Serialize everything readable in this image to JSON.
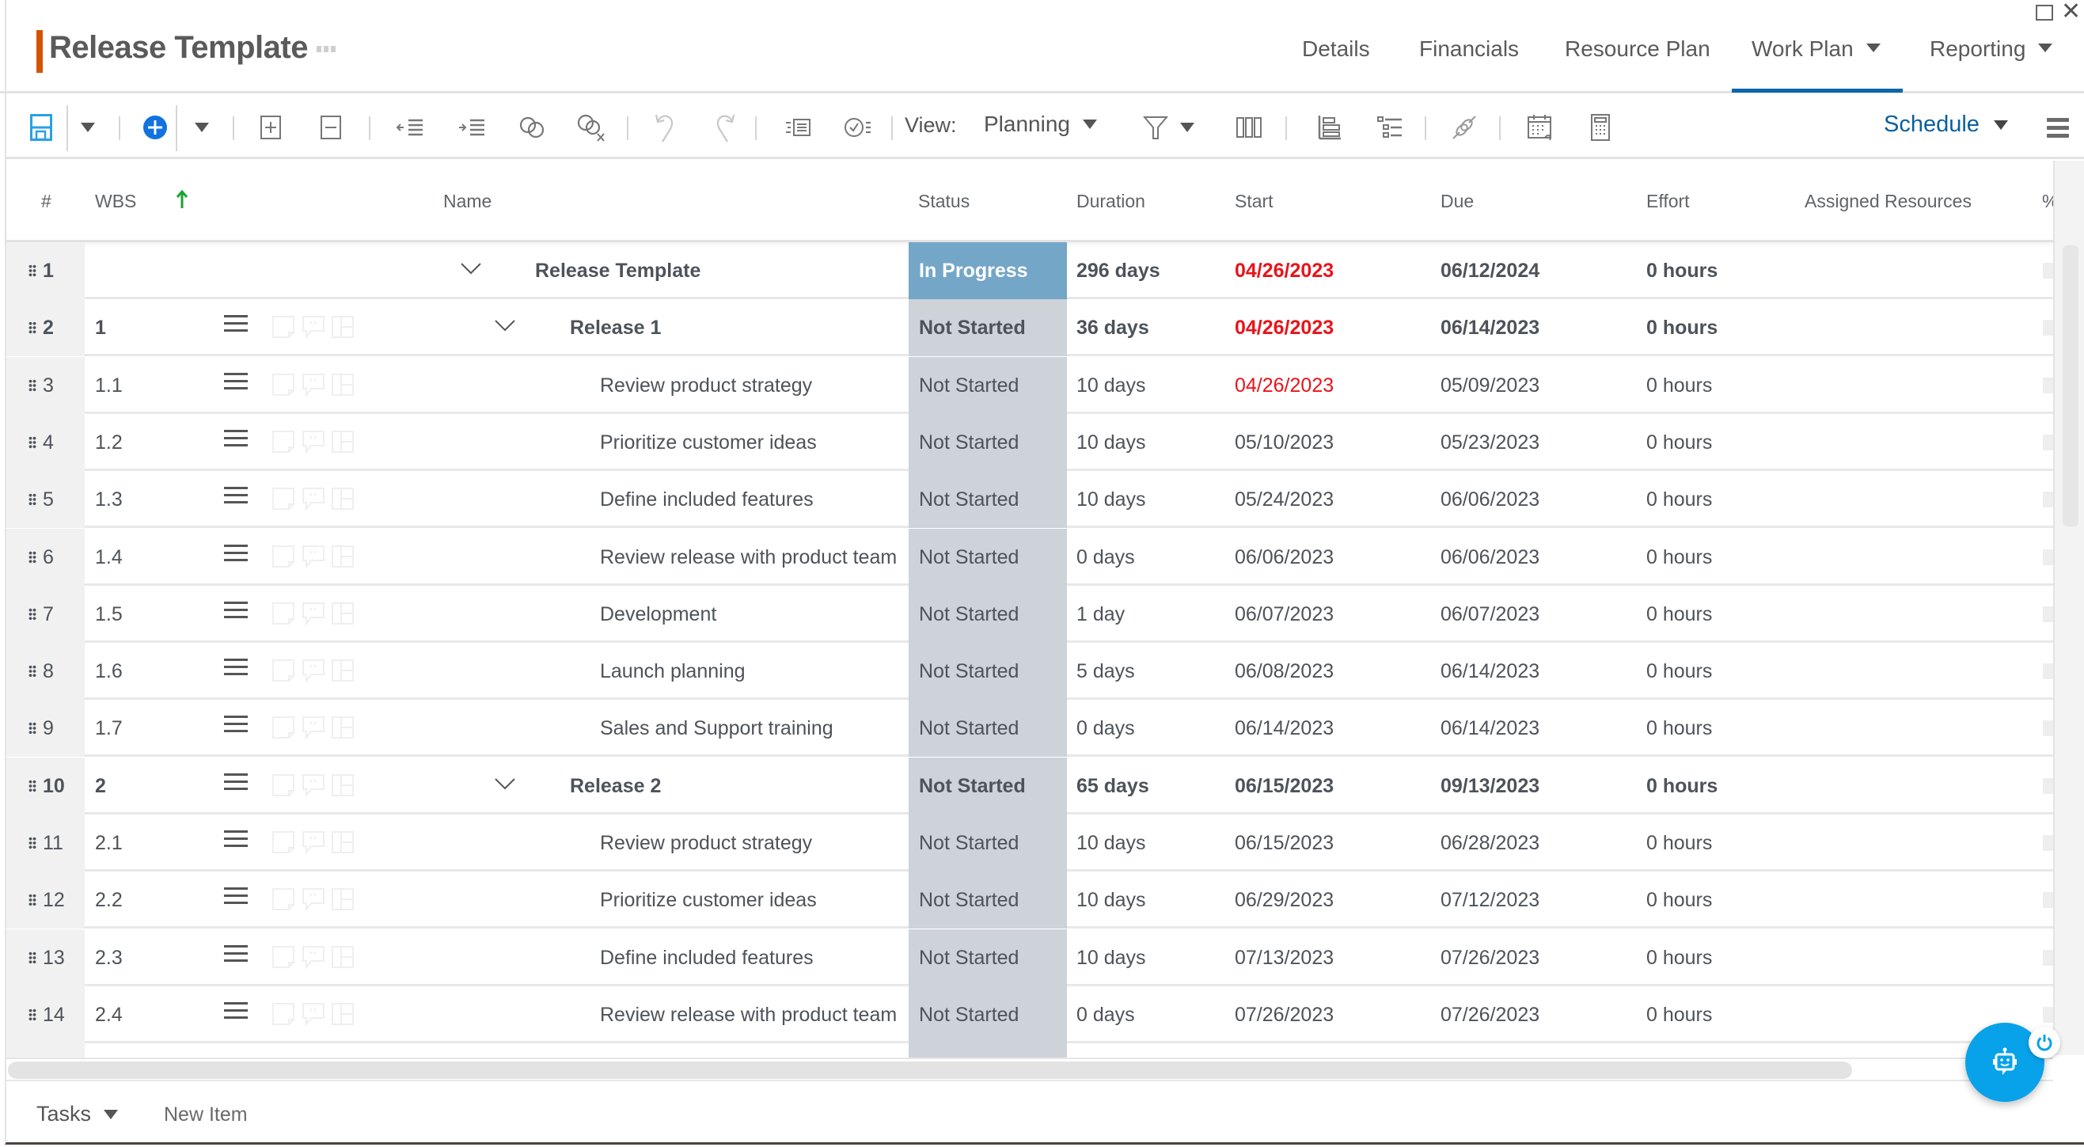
{
  "window": {
    "popout_icon": "popout-icon",
    "close_icon": "close-icon",
    "close_glyph": "✕"
  },
  "header": {
    "title": "Release Template",
    "more_icon": "more-dots-icon",
    "accent_color": "#d35400"
  },
  "nav": {
    "tabs": [
      {
        "label": "Details",
        "dropdown": false,
        "active": false
      },
      {
        "label": "Financials",
        "dropdown": false,
        "active": false
      },
      {
        "label": "Resource Plan",
        "dropdown": false,
        "active": false
      },
      {
        "label": "Work Plan",
        "dropdown": true,
        "active": true
      },
      {
        "label": "Reporting",
        "dropdown": true,
        "active": false
      }
    ],
    "active_color": "#0a68a8"
  },
  "toolbar": {
    "icons": [
      "save-icon",
      "add-icon",
      "expand-all-icon",
      "collapse-all-icon",
      "outdent-icon",
      "indent-icon",
      "link-icon",
      "unlink-icon",
      "undo-icon",
      "redo-icon",
      "details-panel-icon",
      "checklist-icon",
      "filter-icon",
      "columns-icon",
      "baseline-icon",
      "outline-icon",
      "dependency-icon",
      "calendar-icon",
      "calculator-icon",
      "menu-icon"
    ],
    "view_label": "View:",
    "view_value": "Planning",
    "schedule_label": "Schedule",
    "add_color": "#1172e0",
    "save_color": "#29a0e6"
  },
  "grid": {
    "columns": {
      "num": "#",
      "wbs": "WBS",
      "name": "Name",
      "status": "Status",
      "duration": "Duration",
      "start": "Start",
      "due": "Due",
      "effort": "Effort",
      "assigned": "Assigned Resources",
      "pct": "%"
    },
    "sort": {
      "column": "WBS",
      "direction": "ascending",
      "color": "#1aa332"
    },
    "status_colors": {
      "In Progress": "#74a6c8",
      "Not Started": "#ced2d9"
    },
    "late_date_color": "#e8131b",
    "rows": [
      {
        "num": "1",
        "wbs": "",
        "name": "Release Template",
        "level": 0,
        "summary": true,
        "status": "In Progress",
        "duration": "296 days",
        "start": "04/26/2023",
        "start_late": true,
        "due": "06/12/2024",
        "effort": "0 hours",
        "assigned": ""
      },
      {
        "num": "2",
        "wbs": "1",
        "name": "Release 1",
        "level": 1,
        "summary": true,
        "status": "Not Started",
        "duration": "36 days",
        "start": "04/26/2023",
        "start_late": true,
        "due": "06/14/2023",
        "effort": "0 hours",
        "assigned": ""
      },
      {
        "num": "3",
        "wbs": "1.1",
        "name": "Review product strategy",
        "level": 2,
        "summary": false,
        "status": "Not Started",
        "duration": "10 days",
        "start": "04/26/2023",
        "start_late": true,
        "due": "05/09/2023",
        "effort": "0 hours",
        "assigned": ""
      },
      {
        "num": "4",
        "wbs": "1.2",
        "name": "Prioritize customer ideas",
        "level": 2,
        "summary": false,
        "status": "Not Started",
        "duration": "10 days",
        "start": "05/10/2023",
        "start_late": false,
        "due": "05/23/2023",
        "effort": "0 hours",
        "assigned": ""
      },
      {
        "num": "5",
        "wbs": "1.3",
        "name": "Define included features",
        "level": 2,
        "summary": false,
        "status": "Not Started",
        "duration": "10 days",
        "start": "05/24/2023",
        "start_late": false,
        "due": "06/06/2023",
        "effort": "0 hours",
        "assigned": ""
      },
      {
        "num": "6",
        "wbs": "1.4",
        "name": "Review release with product team",
        "level": 2,
        "summary": false,
        "status": "Not Started",
        "duration": "0 days",
        "start": "06/06/2023",
        "start_late": false,
        "due": "06/06/2023",
        "effort": "0 hours",
        "assigned": ""
      },
      {
        "num": "7",
        "wbs": "1.5",
        "name": "Development",
        "level": 2,
        "summary": false,
        "status": "Not Started",
        "duration": "1 day",
        "start": "06/07/2023",
        "start_late": false,
        "due": "06/07/2023",
        "effort": "0 hours",
        "assigned": ""
      },
      {
        "num": "8",
        "wbs": "1.6",
        "name": "Launch planning",
        "level": 2,
        "summary": false,
        "status": "Not Started",
        "duration": "5 days",
        "start": "06/08/2023",
        "start_late": false,
        "due": "06/14/2023",
        "effort": "0 hours",
        "assigned": ""
      },
      {
        "num": "9",
        "wbs": "1.7",
        "name": "Sales and Support training",
        "level": 2,
        "summary": false,
        "status": "Not Started",
        "duration": "0 days",
        "start": "06/14/2023",
        "start_late": false,
        "due": "06/14/2023",
        "effort": "0 hours",
        "assigned": ""
      },
      {
        "num": "10",
        "wbs": "2",
        "name": "Release 2",
        "level": 1,
        "summary": true,
        "status": "Not Started",
        "duration": "65 days",
        "start": "06/15/2023",
        "start_late": false,
        "due": "09/13/2023",
        "effort": "0 hours",
        "assigned": ""
      },
      {
        "num": "11",
        "wbs": "2.1",
        "name": "Review product strategy",
        "level": 2,
        "summary": false,
        "status": "Not Started",
        "duration": "10 days",
        "start": "06/15/2023",
        "start_late": false,
        "due": "06/28/2023",
        "effort": "0 hours",
        "assigned": ""
      },
      {
        "num": "12",
        "wbs": "2.2",
        "name": "Prioritize customer ideas",
        "level": 2,
        "summary": false,
        "status": "Not Started",
        "duration": "10 days",
        "start": "06/29/2023",
        "start_late": false,
        "due": "07/12/2023",
        "effort": "0 hours",
        "assigned": ""
      },
      {
        "num": "13",
        "wbs": "2.3",
        "name": "Define included features",
        "level": 2,
        "summary": false,
        "status": "Not Started",
        "duration": "10 days",
        "start": "07/13/2023",
        "start_late": false,
        "due": "07/26/2023",
        "effort": "0 hours",
        "assigned": ""
      },
      {
        "num": "14",
        "wbs": "2.4",
        "name": "Review release with product team",
        "level": 2,
        "summary": false,
        "status": "Not Started",
        "duration": "0 days",
        "start": "07/26/2023",
        "start_late": false,
        "due": "07/26/2023",
        "effort": "0 hours",
        "assigned": ""
      }
    ]
  },
  "footer": {
    "tasks_label": "Tasks",
    "new_item_label": "New Item"
  },
  "chat": {
    "icon": "chatbot-icon",
    "power_icon": "power-icon",
    "color": "#08a2ea"
  }
}
